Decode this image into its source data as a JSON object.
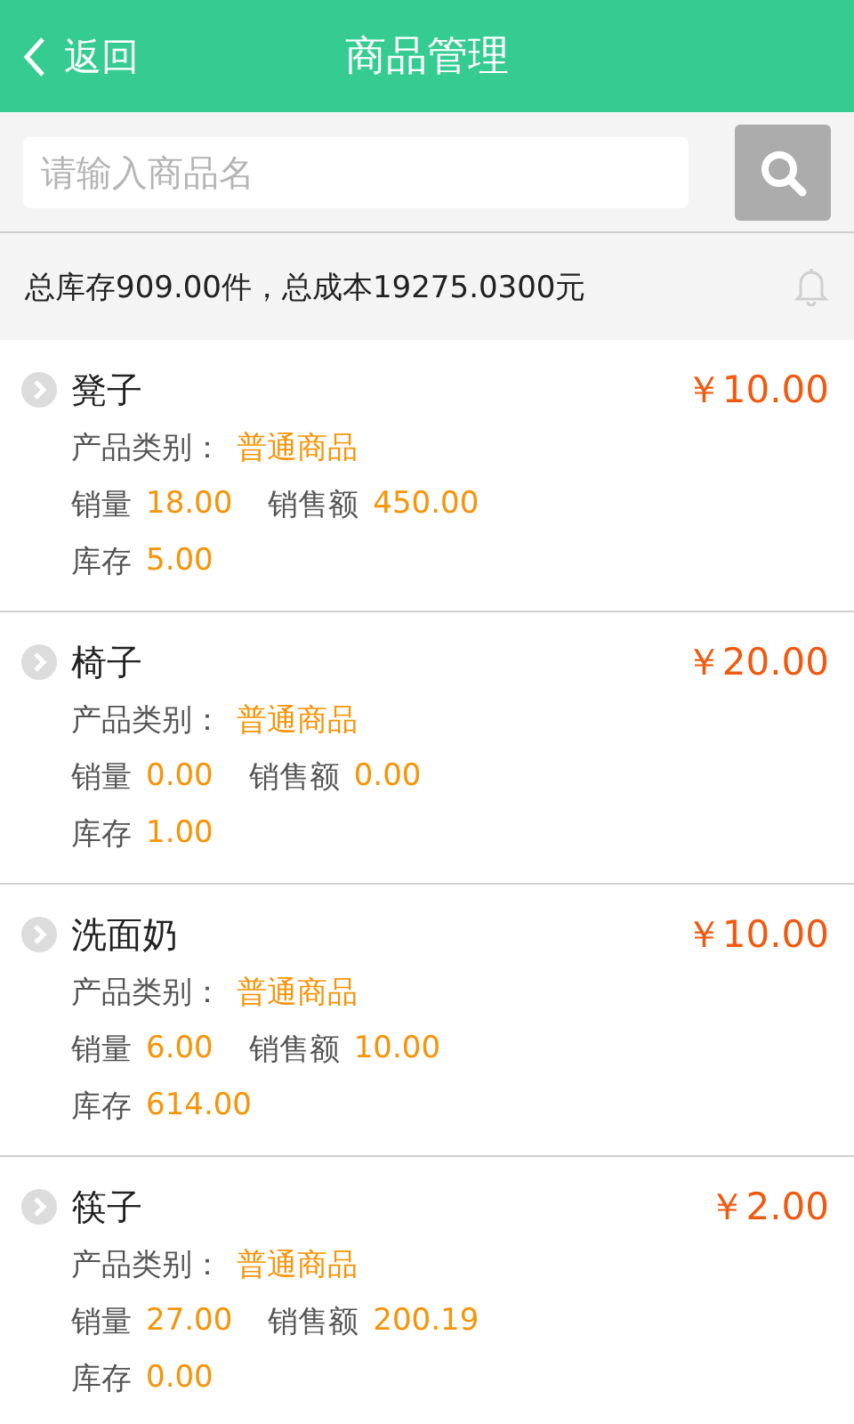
{
  "header": {
    "back_label": "返回",
    "title": "商品管理"
  },
  "search": {
    "placeholder": "请输入商品名"
  },
  "summary": {
    "text": "总库存909.00件，总成本19275.0300元"
  },
  "products": [
    {
      "name": "凳子",
      "price": "￥10.00",
      "category_label": "产品类别：",
      "category": "普通商品",
      "sales_label": "销量",
      "sales": "18.00",
      "revenue_label": "销售额",
      "revenue": "450.00",
      "stock_label": "库存",
      "stock": "5.00"
    },
    {
      "name": "椅子",
      "price": "￥20.00",
      "category_label": "产品类别：",
      "category": "普通商品",
      "sales_label": "销量",
      "sales": "0.00",
      "revenue_label": "销售额",
      "revenue": "0.00",
      "stock_label": "库存",
      "stock": "1.00"
    },
    {
      "name": "洗面奶",
      "price": "￥10.00",
      "category_label": "产品类别：",
      "category": "普通商品",
      "sales_label": "销量",
      "sales": "6.00",
      "revenue_label": "销售额",
      "revenue": "10.00",
      "stock_label": "库存",
      "stock": "614.00"
    },
    {
      "name": "筷子",
      "price": "￥2.00",
      "category_label": "产品类别：",
      "category": "普通商品",
      "sales_label": "销量",
      "sales": "27.00",
      "revenue_label": "销售额",
      "revenue": "200.19",
      "stock_label": "库存",
      "stock": "0.00"
    }
  ]
}
